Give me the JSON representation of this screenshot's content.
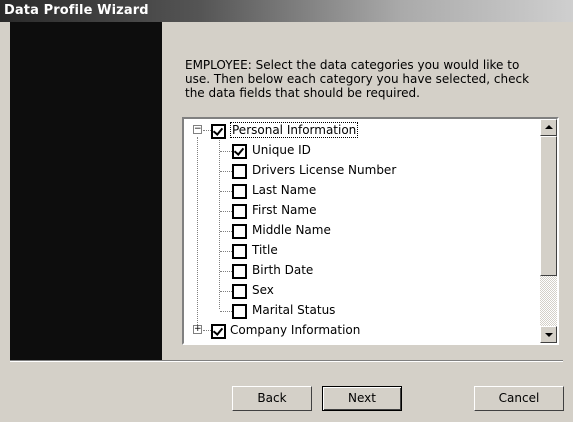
{
  "window": {
    "title": "Data Profile Wizard"
  },
  "instructions": "EMPLOYEE: Select the data categories you would like to use. Then below each category you have selected, check the data fields that should be required.",
  "tree": {
    "categories": [
      {
        "label": "Personal Information",
        "checked": true,
        "expanded": true,
        "expander": "−",
        "fields": [
          {
            "label": "Unique ID",
            "checked": true
          },
          {
            "label": "Drivers License Number",
            "checked": false
          },
          {
            "label": "Last Name",
            "checked": false
          },
          {
            "label": "First Name",
            "checked": false
          },
          {
            "label": "Middle Name",
            "checked": false
          },
          {
            "label": "Title",
            "checked": false
          },
          {
            "label": "Birth Date",
            "checked": false
          },
          {
            "label": "Sex",
            "checked": false
          },
          {
            "label": "Marital Status",
            "checked": false
          }
        ]
      },
      {
        "label": "Company Information",
        "checked": true,
        "expanded": false,
        "expander": "+"
      }
    ]
  },
  "buttons": {
    "back": "Back",
    "next": "Next",
    "cancel": "Cancel"
  }
}
